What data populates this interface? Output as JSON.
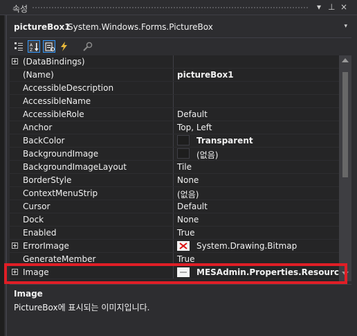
{
  "panel": {
    "title": "속성",
    "controls": {
      "dropdown": "▾",
      "pin": "⊥",
      "close": "×"
    }
  },
  "selector": {
    "object_name": "pictureBox1",
    "object_type": "System.Windows.Forms.PictureBox",
    "dropdown_glyph": "▾"
  },
  "toolbar": {
    "buttons": [
      {
        "icon": "categorized-icon",
        "active": false
      },
      {
        "icon": "alphabetical-icon",
        "active": true
      },
      {
        "icon": "properties-icon",
        "active": true
      },
      {
        "icon": "events-icon",
        "active": false
      },
      {
        "icon": "property-pages-icon",
        "active": false
      }
    ]
  },
  "properties": [
    {
      "name": "(DataBindings)",
      "value": "",
      "expandable": true
    },
    {
      "name": "(Name)",
      "value": "pictureBox1",
      "bold": true
    },
    {
      "name": "AccessibleDescription",
      "value": ""
    },
    {
      "name": "AccessibleName",
      "value": ""
    },
    {
      "name": "AccessibleRole",
      "value": "Default"
    },
    {
      "name": "Anchor",
      "value": "Top, Left"
    },
    {
      "name": "BackColor",
      "value": "Transparent",
      "bold": true,
      "swatch": true
    },
    {
      "name": "BackgroundImage",
      "value": "(없음)",
      "swatch": true
    },
    {
      "name": "BackgroundImageLayout",
      "value": "Tile"
    },
    {
      "name": "BorderStyle",
      "value": "None"
    },
    {
      "name": "ContextMenuStrip",
      "value": "(없음)"
    },
    {
      "name": "Cursor",
      "value": "Default"
    },
    {
      "name": "Dock",
      "value": "None"
    },
    {
      "name": "Enabled",
      "value": "True"
    },
    {
      "name": "ErrorImage",
      "value": "System.Drawing.Bitmap",
      "expandable": true,
      "error_thumb": true
    },
    {
      "name": "GenerateMember",
      "value": "True"
    },
    {
      "name": "Image",
      "value": "MESAdmin.Properties.Resources.loa",
      "expandable": true,
      "bold": true,
      "image_thumb": true
    }
  ],
  "description": {
    "title": "Image",
    "text": "PictureBox에 표시되는 이미지입니다."
  },
  "colors": {
    "background": "#2d2d30",
    "grid": "#252526",
    "highlight": "#e01e26",
    "accent": "#3399ff"
  }
}
